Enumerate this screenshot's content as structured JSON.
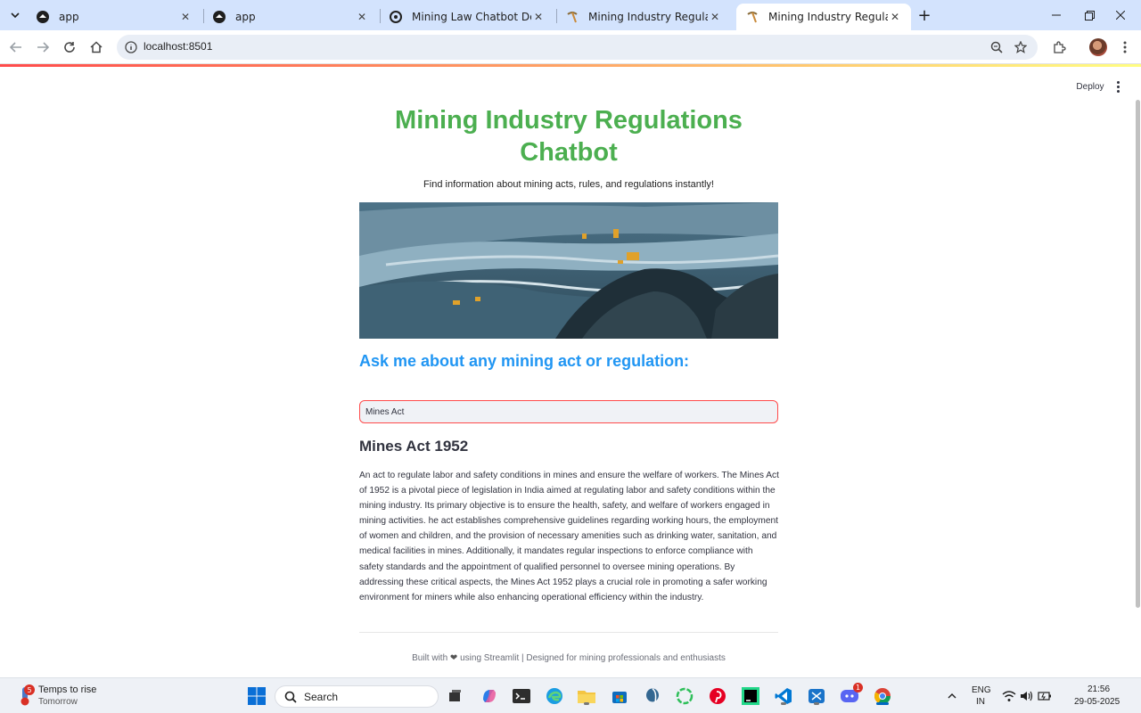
{
  "browser": {
    "tabs": [
      {
        "title": "app",
        "icon": "streamlit-icon",
        "active": false
      },
      {
        "title": "app",
        "icon": "streamlit-icon",
        "active": false
      },
      {
        "title": "Mining Law Chatbot Dev",
        "icon": "openai-icon",
        "active": false
      },
      {
        "title": "Mining Industry Regulations Ch",
        "icon": "pickaxe-icon",
        "active": false
      },
      {
        "title": "Mining Industry Regulations Ch",
        "icon": "pickaxe-icon",
        "active": true
      }
    ],
    "url": "localhost:8501"
  },
  "app": {
    "deploy_label": "Deploy",
    "title": "Mining Industry Regulations Chatbot",
    "subtitle": "Find information about mining acts, rules, and regulations instantly!",
    "ask_heading": "Ask me about any mining act or regulation:",
    "query_value": "Mines Act",
    "result_title": "Mines Act 1952",
    "result_description": "An act to regulate labor and safety conditions in mines and ensure the welfare of workers. The Mines Act of 1952 is a pivotal piece of legislation in India aimed at regulating labor and safety conditions within the mining industry. Its primary objective is to ensure the health, safety, and welfare of workers engaged in mining activities. he act establishes comprehensive guidelines regarding working hours, the employment of women and children, and the provision of necessary amenities such as drinking water, sanitation, and medical facilities in mines. Additionally, it mandates regular inspections to enforce compliance with safety standards and the appointment of qualified personnel to oversee mining operations. By addressing these critical aspects, the Mines Act 1952 plays a crucial role in promoting a safer working environment for miners while also enhancing operational efficiency within the industry.",
    "footer_prefix": "Built with",
    "footer_suffix": "using Streamlit | Designed for mining professionals and enthusiasts",
    "accent_title": "#4caf50",
    "accent_heading": "#2196f3"
  },
  "taskbar": {
    "weather_line1": "Temps to rise",
    "weather_line2": "Tomorrow",
    "weather_badge": "5",
    "search_label": "Search",
    "lang_line1": "ENG",
    "lang_line2": "IN",
    "time": "21:56",
    "date": "29-05-2025",
    "discord_badge": "1"
  }
}
